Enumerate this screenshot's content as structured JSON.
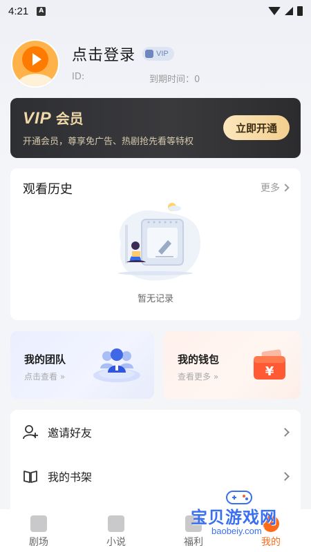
{
  "status_bar": {
    "time": "4:21",
    "app_icon_letter": "A"
  },
  "profile": {
    "login_text": "点击登录",
    "vip_badge": "VIP",
    "id_label": "ID:",
    "expire_label": "到期时间：0"
  },
  "vip_card": {
    "title_main": "VIP",
    "title_sub": "会员",
    "description": "开通会员，尊享免广告、热剧抢先看等特权",
    "button": "立即开通"
  },
  "history": {
    "title": "观看历史",
    "more": "更多",
    "empty_text": "暂无记录"
  },
  "team": {
    "title": "我的团队",
    "subtitle": "点击查看 »"
  },
  "wallet": {
    "title": "我的钱包",
    "subtitle": "查看更多 »",
    "currency_symbol": "¥"
  },
  "menu": [
    {
      "label": "邀请好友",
      "icon": "invite-user-icon"
    },
    {
      "label": "我的书架",
      "icon": "book-icon"
    }
  ],
  "bottom_nav": [
    {
      "label": "剧场",
      "icon": "clapperboard-icon"
    },
    {
      "label": "小说",
      "icon": "book-icon"
    },
    {
      "label": "福利",
      "icon": "gift-icon"
    },
    {
      "label": "我的",
      "icon": "profile-icon",
      "active": true
    }
  ],
  "watermark": {
    "main": "宝贝游戏网",
    "sub": "baobeiy.com"
  },
  "colors": {
    "accent": "#ff6a1a",
    "vip_gold": "#f0d8a8",
    "vip_dark": "#2e2f33"
  }
}
